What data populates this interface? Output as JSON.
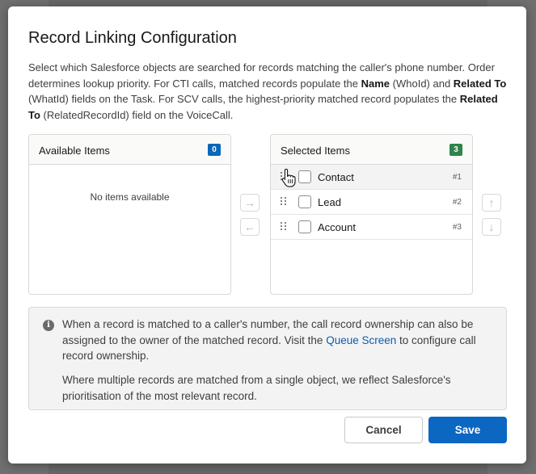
{
  "modal": {
    "title": "Record Linking Configuration",
    "description": {
      "part1": "Select which Salesforce objects are searched for records matching the caller's phone number. Order determines lookup priority. For CTI calls, matched records populate the ",
      "name_field": "Name",
      "part2": " (WhoId) and ",
      "related_field": "Related To",
      "part3": " (WhatId) fields on the Task. For SCV calls, the highest-priority matched record populates the ",
      "related_field2": "Related To",
      "part4": " (RelatedRecordId) field on the VoiceCall."
    }
  },
  "available": {
    "title": "Available Items",
    "count": "0",
    "empty_message": "No items available"
  },
  "selected": {
    "title": "Selected Items",
    "count": "3",
    "items": [
      {
        "label": "Contact",
        "rank": "#1"
      },
      {
        "label": "Lead",
        "rank": "#2"
      },
      {
        "label": "Account",
        "rank": "#3"
      }
    ]
  },
  "icons": {
    "move_right": "→",
    "move_left": "←",
    "move_up": "↑",
    "move_down": "↓",
    "info": "i"
  },
  "info": {
    "p1_before": "When a record is matched to a caller's number, the call record ownership can also be assigned to the owner of the matched record. Visit the ",
    "link": "Queue Screen",
    "p1_after": " to configure call record ownership.",
    "p2": "Where multiple records are matched from a single object, we reflect Salesforce's prioritisation of the most relevant record."
  },
  "buttons": {
    "cancel": "Cancel",
    "save": "Save"
  },
  "colors": {
    "brand": "#0b67c2",
    "available_badge": "#0b67b8",
    "selected_badge": "#2e844a",
    "link": "#0b5cab"
  }
}
